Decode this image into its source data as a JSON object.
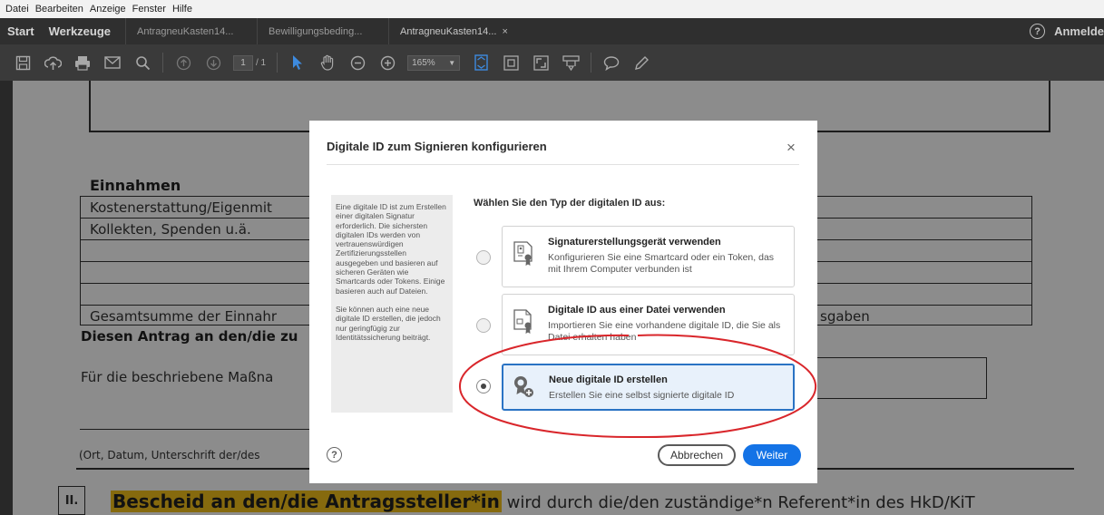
{
  "menu": [
    "Datei",
    "Bearbeiten",
    "Anzeige",
    "Fenster",
    "Hilfe"
  ],
  "tabs": {
    "start": "Start",
    "tools": "Werkzeuge",
    "docs": [
      {
        "label": "AntragneuKasten14...",
        "active": false
      },
      {
        "label": "Bewilligungsbeding...",
        "active": false
      },
      {
        "label": "AntragneuKasten14...",
        "active": true
      }
    ],
    "close_glyph": "×",
    "help_glyph": "?",
    "signin": "Anmelde"
  },
  "toolbar": {
    "page_current": "1",
    "page_total": "/ 1",
    "zoom": "165%",
    "icons": [
      "save-icon",
      "upload-icon",
      "print-icon",
      "mail-icon",
      "search-icon",
      "page-up-icon",
      "page-down-icon",
      "select-cursor-icon",
      "hand-icon",
      "zoom-out-icon",
      "zoom-in-icon",
      "fit-page-icon",
      "rotate-icon",
      "fullscreen-icon",
      "reading-icon",
      "comment-icon",
      "pen-icon"
    ]
  },
  "document": {
    "heading": "Einnahmen",
    "rows": [
      "Kostenerstattung/Eigenmit",
      "Kollekten, Spenden u.ä.",
      "",
      "",
      "Gesamtsumme der Einnahr"
    ],
    "right_fragment": "sgaben",
    "antrag_line": "Diesen Antrag an den/die zu",
    "massnahme": "Für die beschriebene Maßna",
    "signature_line": "(Ort, Datum, Unterschrift der/des",
    "section_number": "II.",
    "section_highlight": "Bescheid an den/die Antragssteller*in",
    "section_rest": " wird durch die/den zuständige*n Referent*in des HkD/KiT"
  },
  "dialog": {
    "title": "Digitale ID zum Signieren konfigurieren",
    "close": "×",
    "info_p1": "Eine digitale ID ist zum Erstellen einer digitalen Signatur erforderlich. Die sichersten digitalen IDs werden von vertrauenswürdigen Zertifizierungsstellen ausgegeben und basieren auf sicheren Geräten wie Smartcards oder Tokens. Einige basieren auch auf Dateien.",
    "info_p2": "Sie können auch eine neue digitale ID erstellen, die jedoch nur geringfügig zur Identitätssicherung beiträgt.",
    "prompt": "Wählen Sie den Typ der digitalen ID aus:",
    "options": [
      {
        "title": "Signaturerstellungsgerät verwenden",
        "desc": "Konfigurieren Sie eine Smartcard oder ein Token, das mit Ihrem Computer verbunden ist",
        "icon": "smartcard-certificate-icon",
        "selected": false
      },
      {
        "title": "Digitale ID aus einer Datei verwenden",
        "desc": "Importieren Sie eine vorhandene digitale ID, die Sie als Datei erhalten haben",
        "icon": "file-certificate-icon",
        "selected": false
      },
      {
        "title": "Neue digitale ID erstellen",
        "desc": "Erstellen Sie eine selbst signierte digitale ID",
        "icon": "new-certificate-icon",
        "selected": true
      }
    ],
    "help": "?",
    "cancel": "Abbrechen",
    "ok": "Weiter"
  },
  "colors": {
    "accent": "#1473e6",
    "selected_border": "#2a73c4",
    "annotation": "#d9262b",
    "highlight": "#f5c21b"
  }
}
